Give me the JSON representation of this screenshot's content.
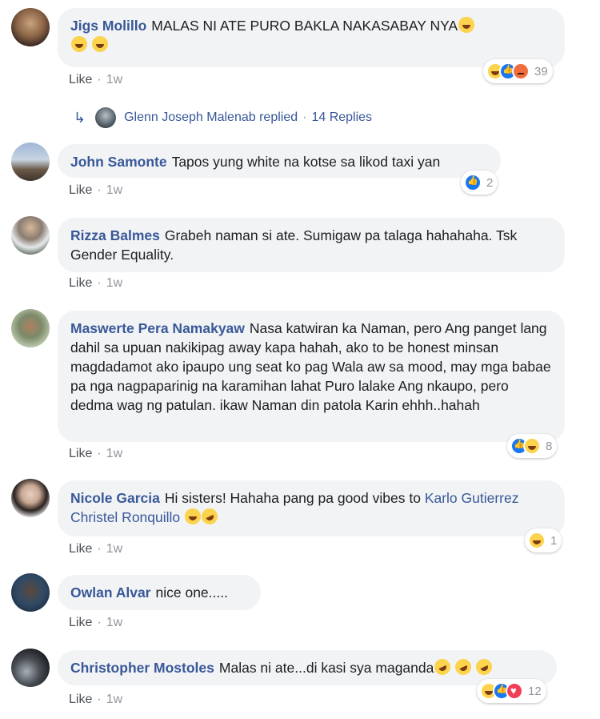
{
  "ui": {
    "like_label": "Like",
    "dot": "·"
  },
  "comments": [
    {
      "author": "Jigs Molillo",
      "text": "MALAS NI ATE PURO BAKLA NAKASABAY NYA",
      "time": "1w",
      "reaction_count": "39",
      "reactions": [
        "haha-icon",
        "like-icon",
        "angry-icon"
      ]
    },
    {
      "author": "John Samonte",
      "text": "Tapos yung white na kotse sa likod taxi yan",
      "time": "1w",
      "reaction_count": "2",
      "reactions": [
        "like-icon"
      ]
    },
    {
      "author": "Rizza Balmes",
      "text": "Grabeh naman si ate. Sumigaw pa talaga hahahaha. Tsk Gender Equality.",
      "time": "1w"
    },
    {
      "author": "Maswerte Pera Namakyaw",
      "text": "Nasa katwiran ka Naman, pero Ang panget lang dahil sa upuan nakikipag away kapa hahah, ako to be honest minsan magdadamot ako ipaupo ung seat ko pag Wala aw sa mood, may mga babae pa nga nagpaparinig na karamihan lahat Puro lalake Ang nkaupo, pero dedma wag ng patulan. ikaw Naman din patola Karin ehhh..hahah",
      "time": "1w",
      "reaction_count": "8",
      "reactions": [
        "like-icon",
        "haha-icon"
      ]
    },
    {
      "author": "Nicole Garcia",
      "text": "Hi sisters! Hahaha pang pa good vibes to",
      "mention1": "Karlo Gutierrez",
      "mention2": "Christel Ronquillo",
      "time": "1w",
      "reaction_count": "1",
      "reactions": [
        "haha-icon"
      ]
    },
    {
      "author": "Owlan Alvar",
      "text": "nice one.....",
      "time": "1w"
    },
    {
      "author": "Christopher Mostoles",
      "text": "Malas ni ate...di kasi sya maganda",
      "time": "1w",
      "reaction_count": "12",
      "reactions": [
        "haha-icon",
        "like-icon",
        "love-icon"
      ]
    }
  ],
  "reply_summary": {
    "name": "Glenn Joseph Malenab replied",
    "sep": "·",
    "count": "14 Replies"
  },
  "colors": {
    "link": "#385898",
    "bubble": "#f2f3f5",
    "meta": "#90949c",
    "like_blue": "#1877f2",
    "haha_yellow": "#fcd34d"
  }
}
